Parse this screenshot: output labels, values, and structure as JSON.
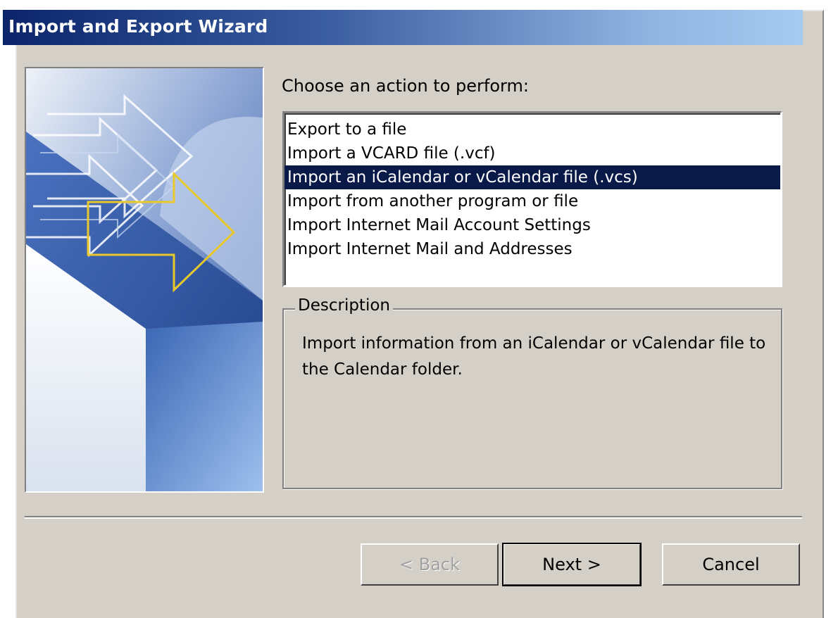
{
  "window": {
    "title": "Import and Export Wizard"
  },
  "prompt": {
    "label": "Choose an action to perform:"
  },
  "actions": [
    {
      "label": "Export to a file",
      "selected": false
    },
    {
      "label": "Import a VCARD file (.vcf)",
      "selected": false
    },
    {
      "label": "Import an iCalendar or vCalendar file (.vcs)",
      "selected": true
    },
    {
      "label": "Import from another program or file",
      "selected": false
    },
    {
      "label": "Import Internet Mail Account Settings",
      "selected": false
    },
    {
      "label": "Import Internet Mail and Addresses",
      "selected": false
    }
  ],
  "description": {
    "legend": "Description",
    "text": "Import information from an iCalendar or vCalendar file to the Calendar folder."
  },
  "buttons": {
    "back": "< Back",
    "next": "Next >",
    "cancel": "Cancel"
  },
  "art": {
    "icon": "wizard-arrows-illustration",
    "accent_color": "#e8c82a",
    "base_color": "#3c64b0"
  },
  "colors": {
    "selection": "#0a1a48",
    "dialog": "#d4d0c8",
    "title_start": "#0b246a",
    "title_end": "#a6caf0"
  }
}
